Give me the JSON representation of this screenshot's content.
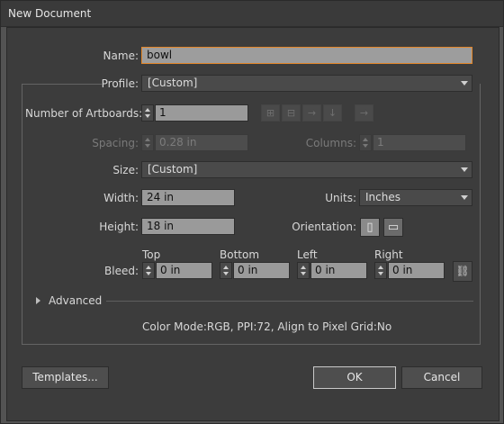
{
  "window": {
    "title": "New Document"
  },
  "name": {
    "label": "Name:",
    "value": "bowl"
  },
  "profile": {
    "label": "Profile:",
    "value": "[Custom]"
  },
  "artboards": {
    "label": "Number of Artboards:",
    "value": "1"
  },
  "spacing": {
    "label": "Spacing:",
    "value": "0.28 in"
  },
  "columns": {
    "label": "Columns:",
    "value": "1"
  },
  "size": {
    "label": "Size:",
    "value": "[Custom]"
  },
  "width": {
    "label": "Width:",
    "value": "24 in"
  },
  "units": {
    "label": "Units:",
    "value": "Inches"
  },
  "height": {
    "label": "Height:",
    "value": "18 in"
  },
  "orientation": {
    "label": "Orientation:",
    "selected": "portrait"
  },
  "bleed": {
    "label": "Bleed:",
    "top": {
      "label": "Top",
      "value": "0 in"
    },
    "bottom": {
      "label": "Bottom",
      "value": "0 in"
    },
    "left": {
      "label": "Left",
      "value": "0 in"
    },
    "right": {
      "label": "Right",
      "value": "0 in"
    }
  },
  "advanced": {
    "label": "Advanced"
  },
  "summary": "Color Mode:RGB, PPI:72, Align to Pixel Grid:No",
  "buttons": {
    "templates": "Templates...",
    "ok": "OK",
    "cancel": "Cancel"
  },
  "colors": {
    "accent": "#e3872a",
    "panel": "#3c3c3c",
    "field": "#9a9a9a"
  }
}
